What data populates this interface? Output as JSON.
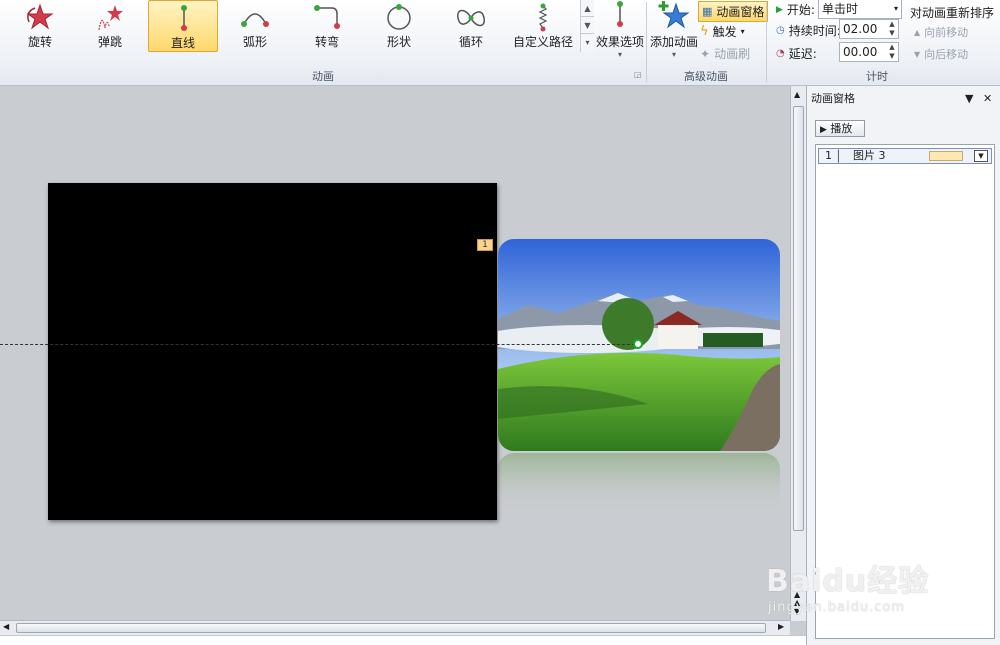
{
  "ribbon": {
    "gallery": [
      {
        "label": "旋转",
        "icon": "spin-star-icon"
      },
      {
        "label": "弹跳",
        "icon": "bounce-star-icon"
      },
      {
        "label": "直线",
        "icon": "line-path-icon",
        "selected": true
      },
      {
        "label": "弧形",
        "icon": "arc-path-icon"
      },
      {
        "label": "转弯",
        "icon": "turn-path-icon"
      },
      {
        "label": "形状",
        "icon": "circle-path-icon"
      },
      {
        "label": "循环",
        "icon": "loop-path-icon"
      },
      {
        "label": "自定义路径",
        "icon": "custom-path-icon"
      }
    ],
    "effect_options": "效果选项",
    "group_animation": "动画",
    "add_animation": "添加动画",
    "animation_pane_toggle": "动画窗格",
    "trigger": "触发",
    "animation_painter": "动画刷",
    "group_advanced": "高级动画",
    "start_label": "开始:",
    "start_value": "单击时",
    "duration_label": "持续时间:",
    "duration_value": "02.00",
    "delay_label": "延迟:",
    "delay_value": "00.00",
    "group_timing": "计时",
    "reorder_title": "对动画重新排序",
    "move_earlier": "向前移动",
    "move_later": "向后移动"
  },
  "slide": {
    "animation_tag": "1"
  },
  "pane": {
    "title": "动画窗格",
    "play": "播放",
    "items": [
      {
        "index": "1",
        "name": "图片 3"
      }
    ]
  },
  "watermark": {
    "brand": "Baidu经验",
    "url": "jingyan.baidu.com"
  },
  "colors": {
    "selected_fill": "#ffd86b",
    "slide_bg": "#000000",
    "workspace_bg": "#c9ccd0",
    "timing_bar": "#fde7b2"
  }
}
